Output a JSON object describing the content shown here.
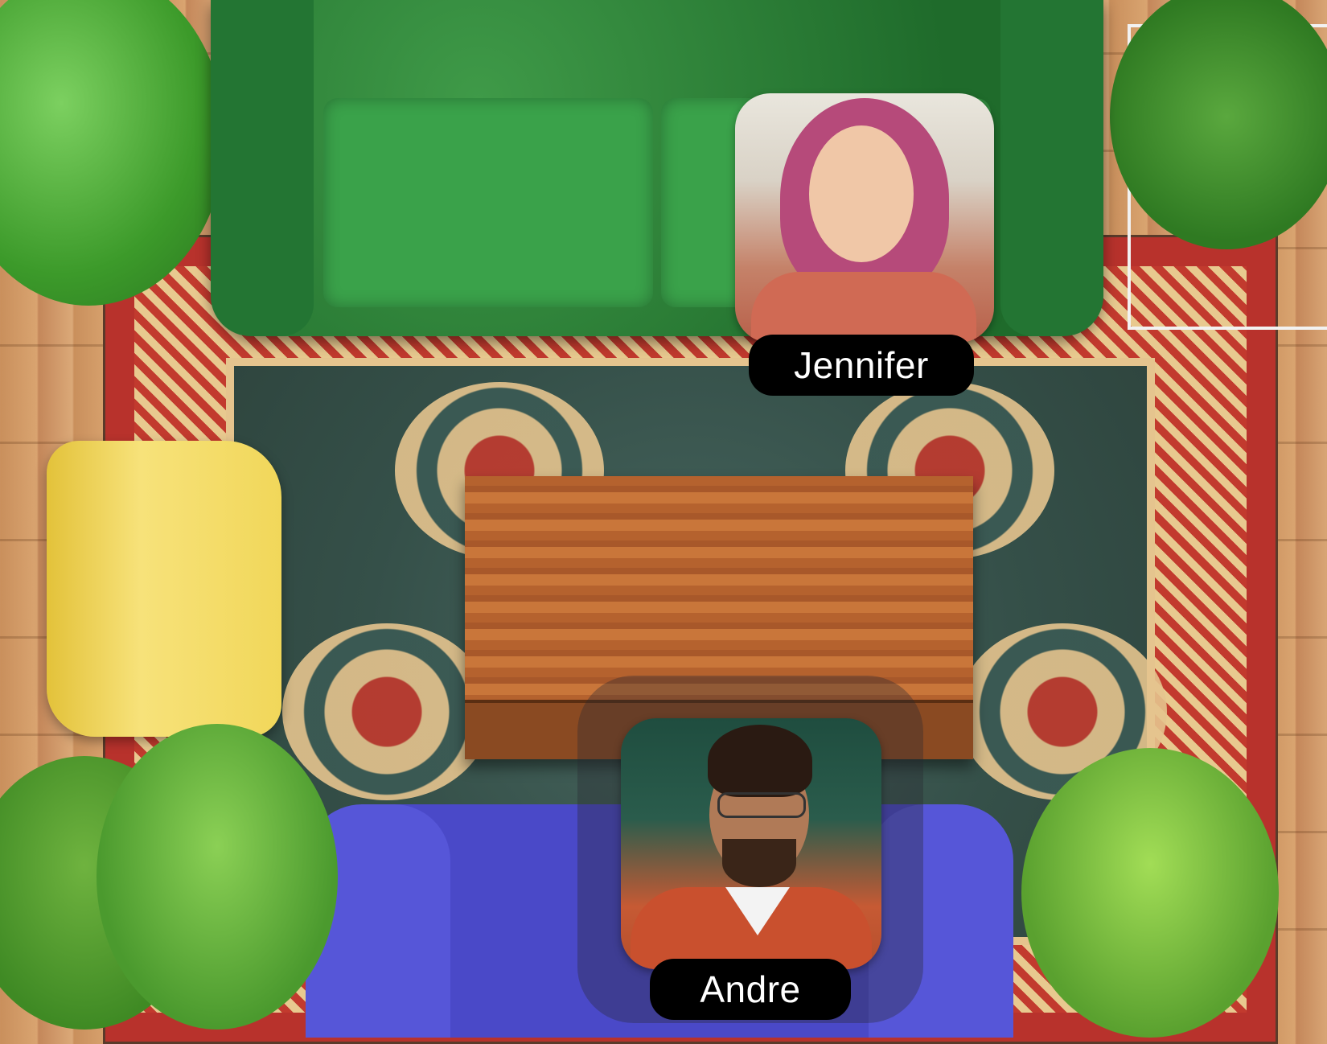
{
  "participants": [
    {
      "name": "Jennifer"
    },
    {
      "name": "Andre"
    }
  ]
}
